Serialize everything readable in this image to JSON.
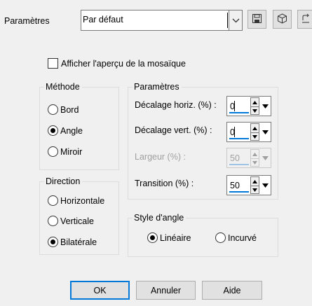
{
  "toolbar": {
    "label": "Paramètres",
    "preset_value": "Par défaut",
    "icons": [
      "chevron-down-icon",
      "save-icon",
      "cube-icon",
      "reset-icon"
    ]
  },
  "show_preview_label": "Afficher l'aperçu de la mosaïque",
  "method": {
    "title": "Méthode",
    "options": [
      "Bord",
      "Angle",
      "Miroir"
    ],
    "selected": "Angle"
  },
  "direction": {
    "title": "Direction",
    "options": [
      "Horizontale",
      "Verticale",
      "Bilatérale"
    ],
    "selected": "Bilatérale"
  },
  "params": {
    "title": "Paramètres",
    "h_offset_label": "Décalage horiz. (%) :",
    "h_offset_value": "0",
    "v_offset_label": "Décalage vert. (%) :",
    "v_offset_value": "0",
    "width_label": "Largeur (%) :",
    "width_value": "50",
    "transition_label": "Transition (%) :",
    "transition_value": "50"
  },
  "corner_style": {
    "title": "Style d'angle",
    "options": [
      "Linéaire",
      "Incurvé"
    ],
    "selected": "Linéaire"
  },
  "buttons": {
    "ok": "OK",
    "cancel": "Annuler",
    "help": "Aide"
  }
}
